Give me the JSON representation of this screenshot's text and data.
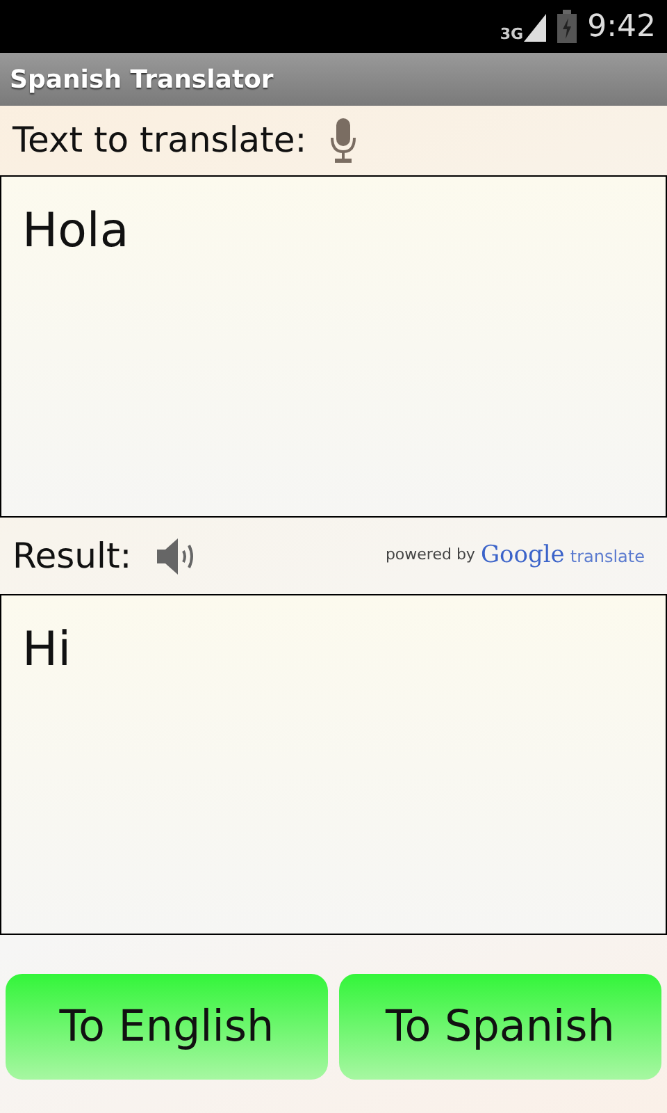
{
  "status_bar": {
    "network": "3G",
    "time": "9:42"
  },
  "title_bar": {
    "title": "Spanish Translator"
  },
  "input_section": {
    "label": "Text to translate:",
    "value": "Hola"
  },
  "result_section": {
    "label": "Result:",
    "attribution": {
      "prefix": "powered by",
      "brand": "Google",
      "suffix": "translate"
    },
    "value": "Hi"
  },
  "buttons": [
    "To English",
    "To Spanish"
  ]
}
